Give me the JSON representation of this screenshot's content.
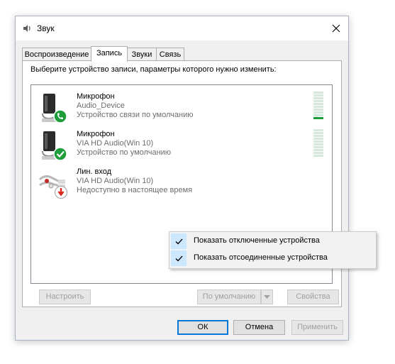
{
  "window": {
    "title": "Звук",
    "title_icon": "speaker-icon",
    "close_icon": "close-icon"
  },
  "tabs": [
    {
      "label": "Воспроизведение",
      "active": false
    },
    {
      "label": "Запись",
      "active": true
    },
    {
      "label": "Звуки",
      "active": false
    },
    {
      "label": "Связь",
      "active": false
    }
  ],
  "instruction": "Выберите устройство записи, параметры которого нужно изменить:",
  "devices": [
    {
      "name": "Микрофон",
      "driver": "Audio_Device",
      "status": "Устройство связи по умолчанию",
      "icon": "microphone-icon",
      "badge": "phone-badge-icon",
      "level_percent": 10
    },
    {
      "name": "Микрофон",
      "driver": "VIA HD Audio(Win 10)",
      "status": "Устройство по умолчанию",
      "icon": "microphone-icon",
      "badge": "checkmark-badge-icon",
      "level_percent": 0
    },
    {
      "name": "Лин. вход",
      "driver": "VIA HD Audio(Win 10)",
      "status": "Недоступно в настоящее время",
      "icon": "line-in-icon",
      "badge": "unavailable-arrow-icon"
    }
  ],
  "context_menu": {
    "items": [
      {
        "label": "Показать отключенные устройства",
        "checked": true
      },
      {
        "label": "Показать отсоединенные устройства",
        "checked": true
      }
    ]
  },
  "buttons": {
    "configure": "Настроить",
    "set_default": "По умолчанию",
    "properties": "Свойства",
    "ok": "ОК",
    "cancel": "Отмена",
    "apply": "Применить"
  },
  "colors": {
    "accent": "#0078d7",
    "badge_green": "#1e9e3a",
    "badge_red": "#d9261c",
    "menu_highlight": "#cce8ff"
  }
}
